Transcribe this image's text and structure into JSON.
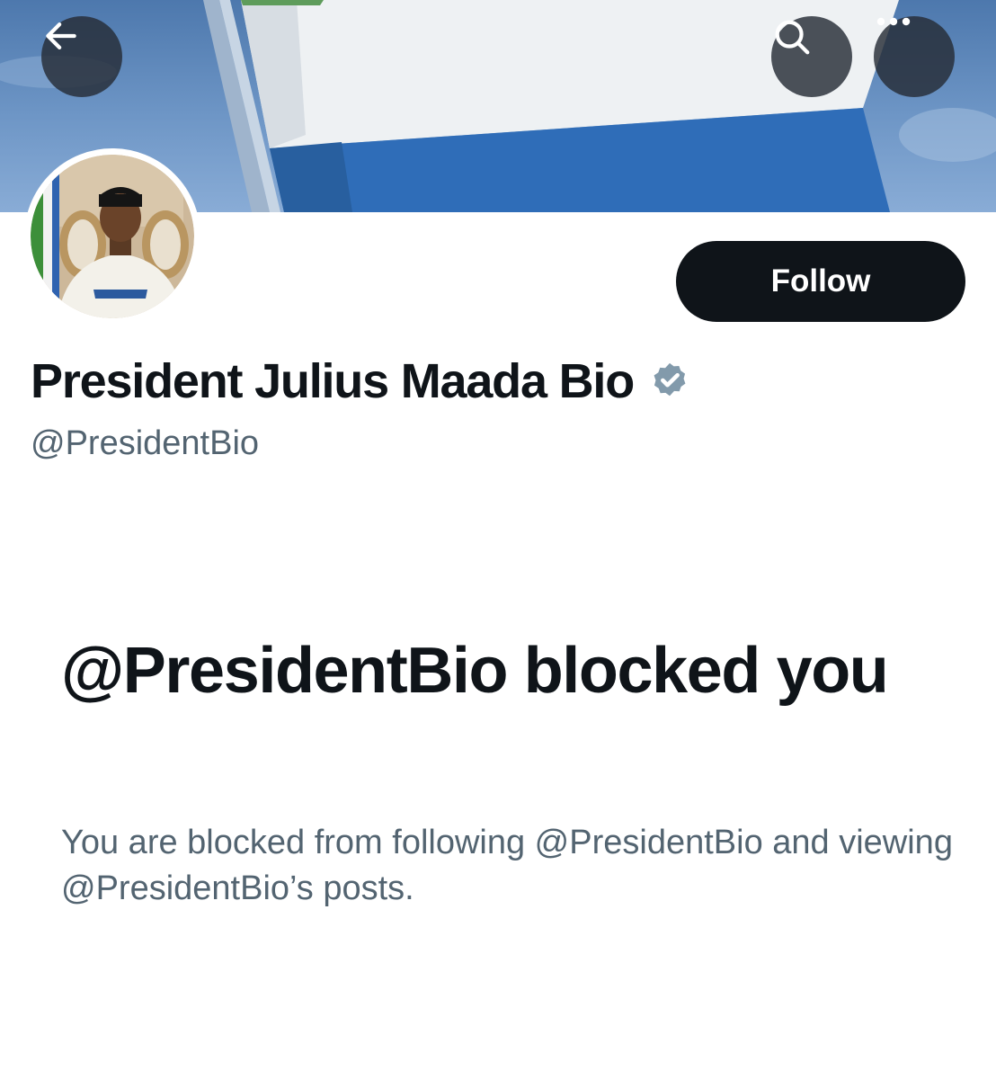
{
  "header": {
    "back_icon": "arrow-left-icon",
    "search_icon": "search-icon",
    "more_icon": "more-horizontal-icon"
  },
  "profile": {
    "display_name": "President Julius Maada Bio",
    "handle": "@PresidentBio",
    "verified_icon": "verified-badge-icon",
    "verified_color": "#829aab",
    "follow_label": "Follow",
    "follow_button_color": "#0f1419"
  },
  "blocked": {
    "title": "@PresidentBio blocked you",
    "description": "You are blocked from following @PresidentBio and viewing @PresidentBio’s posts."
  },
  "colors": {
    "primary_text": "#0f1419",
    "secondary_text": "#536471",
    "background": "#ffffff"
  }
}
